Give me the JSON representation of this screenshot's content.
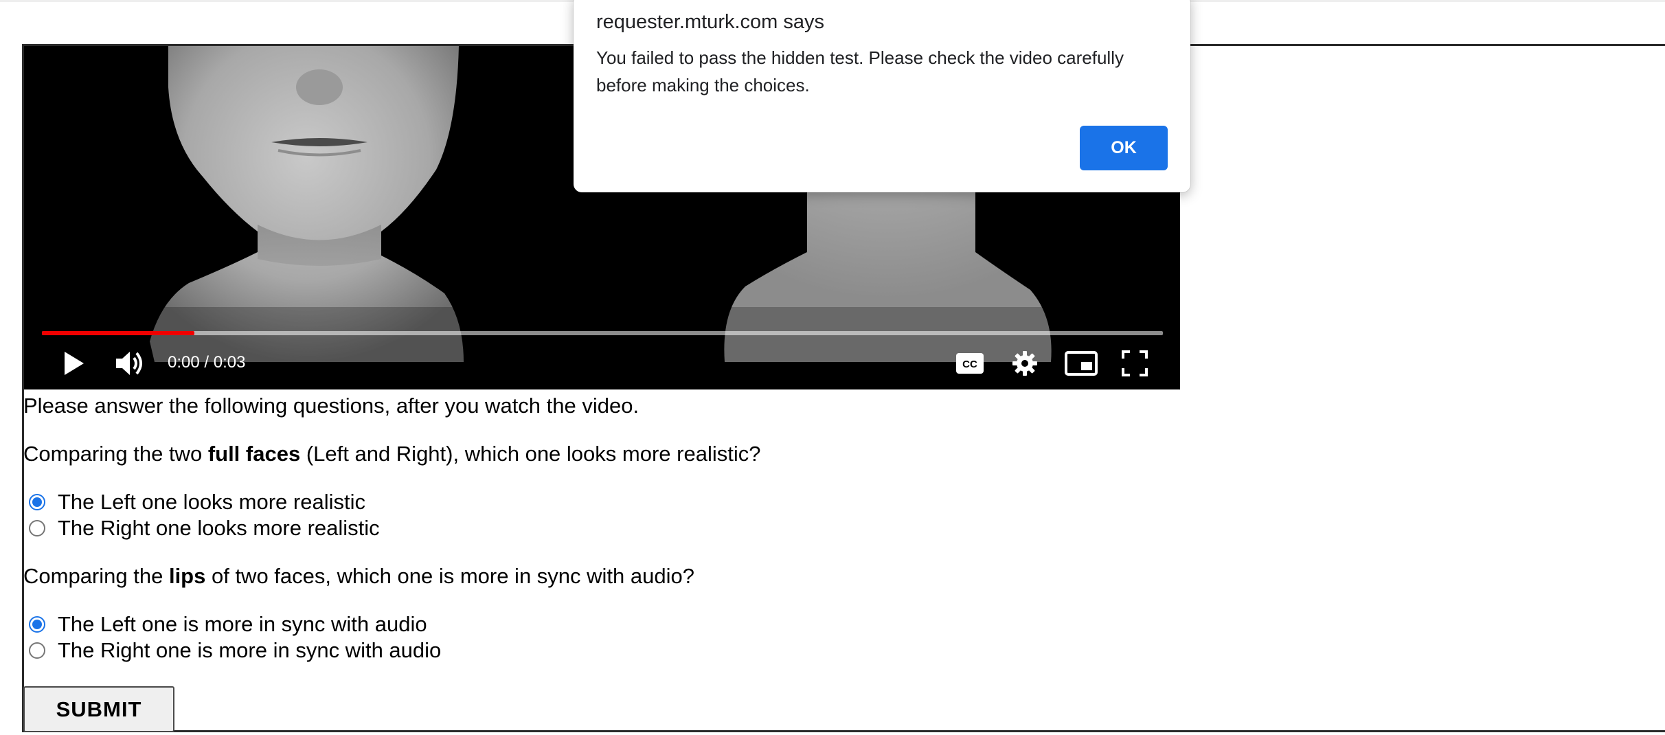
{
  "video": {
    "time_display": "0:00 / 0:03",
    "progress_fraction": 0.136,
    "icons": {
      "play": "play-icon",
      "volume": "volume-icon",
      "captions": "closed-captions-icon",
      "settings": "gear-icon",
      "miniplayer": "miniplayer-icon",
      "fullscreen": "fullscreen-icon"
    },
    "colors": {
      "progress_played": "#f00000",
      "background": "#000000"
    }
  },
  "form": {
    "instruction": "Please answer the following questions, after you watch the video.",
    "q1": {
      "prefix": "Comparing the two ",
      "bold": "full faces",
      "suffix": " (Left and Right), which one looks more realistic?",
      "options": [
        {
          "label": "The Left one looks more realistic",
          "checked": true
        },
        {
          "label": "The Right one looks more realistic",
          "checked": false
        }
      ]
    },
    "q2": {
      "prefix": "Comparing the ",
      "bold": "lips",
      "suffix": " of two faces, which one is more in sync with audio?",
      "options": [
        {
          "label": "The Left one is more in sync with audio",
          "checked": true
        },
        {
          "label": "The Right one is more in sync with audio",
          "checked": false
        }
      ]
    },
    "submit_label": "SUBMIT"
  },
  "dialog": {
    "title": "requester.mturk.com says",
    "message": "You failed to pass the hidden test. Please check the video carefully before making the choices.",
    "ok_label": "OK",
    "accent_color": "#1a73e8"
  }
}
